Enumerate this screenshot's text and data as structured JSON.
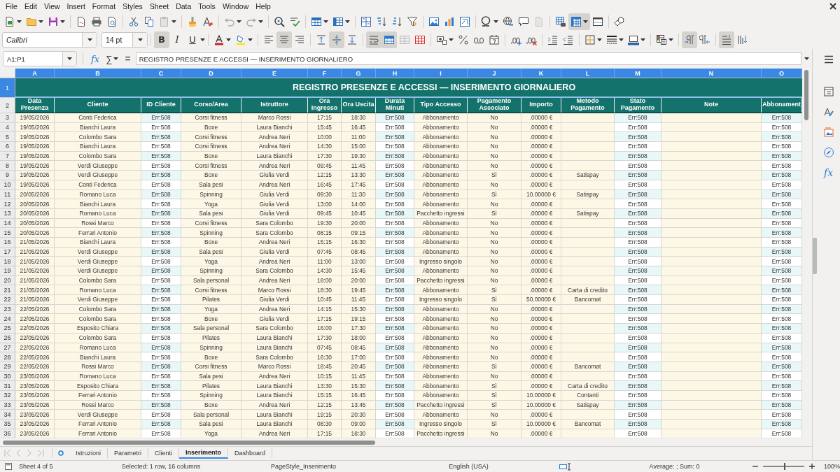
{
  "menu": [
    "File",
    "Edit",
    "View",
    "Insert",
    "Format",
    "Styles",
    "Sheet",
    "Data",
    "Tools",
    "Window",
    "Help"
  ],
  "standard_bar": {
    "pressed": {
      "freeze": true
    }
  },
  "format_bar": {
    "font_name": "Calibri",
    "font_size": "14 pt",
    "style_buttons": [
      {
        "kind": "bold",
        "label": "B",
        "pressed": true
      },
      {
        "kind": "italic",
        "label": "I",
        "pressed": false
      },
      {
        "kind": "underline",
        "label": "U",
        "pressed": false
      }
    ],
    "pressed": {
      "align_left": false,
      "align_center": true,
      "align_right": false,
      "valign_top": false,
      "valign_middle": true,
      "valign_bottom": false,
      "wrap_text": true,
      "merge_cells": true,
      "ltr": true,
      "rtl": false,
      "text_horizontal": true,
      "text_vertical": false
    }
  },
  "formula_bar": {
    "name_box": "A1:P1",
    "function_wizard": "fx",
    "sum": "∑",
    "equals": "=",
    "content": "REGISTRO PRESENZE E ACCESSI — INSERIMENTO GIORNALIERO"
  },
  "sheet": {
    "columns": [
      {
        "letter": "A",
        "header": "Data Presenza",
        "selected": true
      },
      {
        "letter": "B",
        "header": "Cliente",
        "selected": true
      },
      {
        "letter": "C",
        "header": "ID Cliente",
        "selected": true
      },
      {
        "letter": "D",
        "header": "Corso/Area",
        "selected": true
      },
      {
        "letter": "E",
        "header": "Istruttore",
        "selected": true
      },
      {
        "letter": "F",
        "header": "Ora Ingresso",
        "selected": true
      },
      {
        "letter": "G",
        "header": "Ora Uscita",
        "selected": true
      },
      {
        "letter": "H",
        "header": "Durata Minuti",
        "selected": true
      },
      {
        "letter": "I",
        "header": "Tipo Accesso",
        "selected": true
      },
      {
        "letter": "J",
        "header": "Pagamento Associato",
        "selected": true
      },
      {
        "letter": "K",
        "header": "Importo",
        "selected": true
      },
      {
        "letter": "L",
        "header": "Metodo Pagamento",
        "selected": true
      },
      {
        "letter": "M",
        "header": "Stato Pagamento",
        "selected": true
      },
      {
        "letter": "N",
        "header": "Note",
        "selected": true
      },
      {
        "letter": "O",
        "header": "Abbonament",
        "selected": true
      }
    ],
    "title_row": {
      "number": "1",
      "title": "REGISTRO PRESENZE E ACCESSI — INSERIMENTO GIORNALIERO",
      "selected": true
    },
    "header_row": {
      "number": "2",
      "selected": false
    },
    "rows": [
      {
        "number": "3",
        "selected": false,
        "cells": [
          "19/05/2026",
          "Conti Federica",
          "Err:508",
          "Corsi fitness",
          "Marco Rossi",
          "17:15",
          "18:30",
          "Err:508",
          "Abbonamento",
          "No",
          ".00000 €",
          null,
          "Err:508",
          null,
          "Err:508"
        ]
      },
      {
        "number": "4",
        "selected": false,
        "cells": [
          "19/05/2026",
          "Bianchi Laura",
          "Err:508",
          "Boxe",
          "Laura Bianchi",
          "15:45",
          "16:45",
          "Err:508",
          "Abbonamento",
          "No",
          ".00000 €",
          null,
          "Err:508",
          null,
          "Err:508"
        ]
      },
      {
        "number": "5",
        "selected": false,
        "cells": [
          "19/05/2026",
          "Colombo Sara",
          "Err:508",
          "Corsi fitness",
          "Andrea Neri",
          "10:00",
          "11:00",
          "Err:508",
          "Abbonamento",
          "No",
          ".00000 €",
          null,
          "Err:508",
          null,
          "Err:508"
        ]
      },
      {
        "number": "6",
        "selected": false,
        "cells": [
          "19/05/2026",
          "Bianchi Laura",
          "Err:508",
          "Corsi fitness",
          "Andrea Neri",
          "14:30",
          "15:00",
          "Err:508",
          "Abbonamento",
          "No",
          ".00000 €",
          null,
          "Err:508",
          null,
          "Err:508"
        ]
      },
      {
        "number": "7",
        "selected": false,
        "cells": [
          "19/05/2026",
          "Colombo Sara",
          "Err:508",
          "Boxe",
          "Laura Bianchi",
          "17:30",
          "19:30",
          "Err:508",
          "Abbonamento",
          "No",
          ".00000 €",
          null,
          "Err:508",
          null,
          "Err:508"
        ]
      },
      {
        "number": "8",
        "selected": false,
        "cells": [
          "19/05/2026",
          "Verdi Giuseppe",
          "Err:508",
          "Corsi fitness",
          "Andrea Neri",
          "09:45",
          "11:45",
          "Err:508",
          "Abbonamento",
          "No",
          ".00000 €",
          null,
          "Err:508",
          null,
          "Err:508"
        ]
      },
      {
        "number": "9",
        "selected": false,
        "cells": [
          "19/05/2026",
          "Verdi Giuseppe",
          "Err:508",
          "Boxe",
          "Giulia Verdi",
          "12:15",
          "13:30",
          "Err:508",
          "Abbonamento",
          "Sì",
          ".00000 €",
          "Satispay",
          "Err:508",
          null,
          "Err:508"
        ]
      },
      {
        "number": "10",
        "selected": false,
        "cells": [
          "19/05/2026",
          "Conti Federica",
          "Err:508",
          "Sala pesi",
          "Andrea Neri",
          "16:45",
          "17:45",
          "Err:508",
          "Abbonamento",
          "No",
          ".00000 €",
          null,
          "Err:508",
          null,
          "Err:508"
        ]
      },
      {
        "number": "11",
        "selected": false,
        "cells": [
          "20/05/2026",
          "Romano Luca",
          "Err:508",
          "Spinning",
          "Giulia Verdi",
          "09:30",
          "11:30",
          "Err:508",
          "Abbonamento",
          "Sì",
          "10.00000 €",
          "Satispay",
          "Err:508",
          null,
          "Err:508"
        ]
      },
      {
        "number": "12",
        "selected": false,
        "cells": [
          "20/05/2026",
          "Bianchi Laura",
          "Err:508",
          "Yoga",
          "Giulia Verdi",
          "13:00",
          "14:00",
          "Err:508",
          "Abbonamento",
          "No",
          ".00000 €",
          null,
          "Err:508",
          null,
          "Err:508"
        ]
      },
      {
        "number": "13",
        "selected": false,
        "cells": [
          "20/05/2026",
          "Romano Luca",
          "Err:508",
          "Sala pesi",
          "Giulia Verdi",
          "09:45",
          "10:45",
          "Err:508",
          "Pacchetto ingressi",
          "Sì",
          ".00000 €",
          "Satispay",
          "Err:508",
          null,
          "Err:508"
        ]
      },
      {
        "number": "14",
        "selected": false,
        "cells": [
          "20/05/2026",
          "Rossi Marco",
          "Err:508",
          "Corsi fitness",
          "Sara Colombo",
          "19:30",
          "20:00",
          "Err:508",
          "Abbonamento",
          "No",
          ".00000 €",
          null,
          "Err:508",
          null,
          "Err:508"
        ]
      },
      {
        "number": "15",
        "selected": false,
        "cells": [
          "20/05/2026",
          "Ferrari Antonio",
          "Err:508",
          "Spinning",
          "Sara Colombo",
          "08:15",
          "09:15",
          "Err:508",
          "Abbonamento",
          "No",
          ".00000 €",
          null,
          "Err:508",
          null,
          "Err:508"
        ]
      },
      {
        "number": "16",
        "selected": false,
        "cells": [
          "21/05/2026",
          "Bianchi Laura",
          "Err:508",
          "Boxe",
          "Andrea Neri",
          "15:15",
          "16:30",
          "Err:508",
          "Abbonamento",
          "No",
          ".00000 €",
          null,
          "Err:508",
          null,
          "Err:508"
        ]
      },
      {
        "number": "17",
        "selected": false,
        "cells": [
          "21/05/2026",
          "Verdi Giuseppe",
          "Err:508",
          "Sala pesi",
          "Giulia Verdi",
          "07:45",
          "08:45",
          "Err:508",
          "Abbonamento",
          "No",
          ".00000 €",
          null,
          "Err:508",
          null,
          "Err:508"
        ]
      },
      {
        "number": "18",
        "selected": false,
        "cells": [
          "21/05/2026",
          "Verdi Giuseppe",
          "Err:508",
          "Yoga",
          "Andrea Neri",
          "11:00",
          "13:00",
          "Err:508",
          "Ingresso singolo",
          "No",
          ".00000 €",
          null,
          "Err:508",
          null,
          "Err:508"
        ]
      },
      {
        "number": "19",
        "selected": false,
        "cells": [
          "21/05/2026",
          "Verdi Giuseppe",
          "Err:508",
          "Spinning",
          "Sara Colombo",
          "14:30",
          "15:45",
          "Err:508",
          "Abbonamento",
          "No",
          ".00000 €",
          null,
          "Err:508",
          null,
          "Err:508"
        ]
      },
      {
        "number": "20",
        "selected": false,
        "cells": [
          "21/05/2026",
          "Colombo Sara",
          "Err:508",
          "Sala personal",
          "Andrea Neri",
          "18:00",
          "20:00",
          "Err:508",
          "Pacchetto ingressi",
          "No",
          ".00000 €",
          null,
          "Err:508",
          null,
          "Err:508"
        ]
      },
      {
        "number": "21",
        "selected": false,
        "cells": [
          "21/05/2026",
          "Romano Luca",
          "Err:508",
          "Corsi fitness",
          "Marco Rossi",
          "18:30",
          "19:45",
          "Err:508",
          "Abbonamento",
          "Sì",
          ".00000 €",
          "Carta di credito",
          "Err:508",
          null,
          "Err:508"
        ]
      },
      {
        "number": "22",
        "selected": false,
        "cells": [
          "21/05/2026",
          "Verdi Giuseppe",
          "Err:508",
          "Pilates",
          "Giulia Verdi",
          "10:45",
          "11:45",
          "Err:508",
          "Ingresso singolo",
          "Sì",
          "50.00000 €",
          "Bancomat",
          "Err:508",
          null,
          "Err:508"
        ]
      },
      {
        "number": "23",
        "selected": false,
        "cells": [
          "22/05/2026",
          "Colombo Sara",
          "Err:508",
          "Yoga",
          "Andrea Neri",
          "14:15",
          "15:30",
          "Err:508",
          "Abbonamento",
          "No",
          ".00000 €",
          null,
          "Err:508",
          null,
          "Err:508"
        ]
      },
      {
        "number": "24",
        "selected": false,
        "cells": [
          "22/05/2026",
          "Colombo Sara",
          "Err:508",
          "Boxe",
          "Giulia Verdi",
          "17:15",
          "19:15",
          "Err:508",
          "Abbonamento",
          "No",
          ".00000 €",
          null,
          "Err:508",
          null,
          "Err:508"
        ]
      },
      {
        "number": "25",
        "selected": false,
        "cells": [
          "22/05/2026",
          "Esposito Chiara",
          "Err:508",
          "Sala personal",
          "Sara Colombo",
          "16:00",
          "17:30",
          "Err:508",
          "Abbonamento",
          "No",
          ".00000 €",
          null,
          "Err:508",
          null,
          "Err:508"
        ]
      },
      {
        "number": "26",
        "selected": false,
        "cells": [
          "22/05/2026",
          "Colombo Sara",
          "Err:508",
          "Pilates",
          "Laura Bianchi",
          "17:30",
          "18:00",
          "Err:508",
          "Abbonamento",
          "No",
          ".00000 €",
          null,
          "Err:508",
          null,
          "Err:508"
        ]
      },
      {
        "number": "27",
        "selected": false,
        "cells": [
          "22/05/2026",
          "Romano Luca",
          "Err:508",
          "Spinning",
          "Laura Bianchi",
          "07:45",
          "08:45",
          "Err:508",
          "Abbonamento",
          "No",
          ".00000 €",
          null,
          "Err:508",
          null,
          "Err:508"
        ]
      },
      {
        "number": "28",
        "selected": false,
        "cells": [
          "22/05/2026",
          "Bianchi Laura",
          "Err:508",
          "Boxe",
          "Sara Colombo",
          "16:30",
          "17:00",
          "Err:508",
          "Abbonamento",
          "No",
          ".00000 €",
          null,
          "Err:508",
          null,
          "Err:508"
        ]
      },
      {
        "number": "29",
        "selected": false,
        "cells": [
          "22/05/2026",
          "Rossi Marco",
          "Err:508",
          "Corsi fitness",
          "Marco Rossi",
          "18:45",
          "20:45",
          "Err:508",
          "Abbonamento",
          "Sì",
          ".00000 €",
          "Bancomat",
          "Err:508",
          null,
          "Err:508"
        ]
      },
      {
        "number": "30",
        "selected": false,
        "cells": [
          "23/05/2026",
          "Romano Luca",
          "Err:508",
          "Sala pesi",
          "Andrea Neri",
          "10:15",
          "11:45",
          "Err:508",
          "Abbonamento",
          "No",
          ".00000 €",
          null,
          "Err:508",
          null,
          "Err:508"
        ]
      },
      {
        "number": "31",
        "selected": false,
        "cells": [
          "23/05/2026",
          "Esposito Chiara",
          "Err:508",
          "Pilates",
          "Laura Bianchi",
          "13:30",
          "15:30",
          "Err:508",
          "Abbonamento",
          "Sì",
          ".00000 €",
          "Carta di credito",
          "Err:508",
          null,
          "Err:508"
        ]
      },
      {
        "number": "32",
        "selected": false,
        "cells": [
          "23/05/2026",
          "Ferrari Antonio",
          "Err:508",
          "Spinning",
          "Laura Bianchi",
          "15:15",
          "16:45",
          "Err:508",
          "Abbonamento",
          "Sì",
          "10.00000 €",
          "Contanti",
          "Err:508",
          null,
          "Err:508"
        ]
      },
      {
        "number": "33",
        "selected": false,
        "cells": [
          "23/05/2026",
          "Rossi Marco",
          "Err:508",
          "Boxe",
          "Andrea Neri",
          "12:15",
          "13:45",
          "Err:508",
          "Pacchetto ingressi",
          "Sì",
          "10.00000 €",
          "Satispay",
          "Err:508",
          null,
          "Err:508"
        ]
      },
      {
        "number": "34",
        "selected": false,
        "cells": [
          "23/05/2026",
          "Verdi Giuseppe",
          "Err:508",
          "Sala personal",
          "Laura Bianchi",
          "19:15",
          "20:30",
          "Err:508",
          "Abbonamento",
          "No",
          ".00000 €",
          null,
          "Err:508",
          null,
          "Err:508"
        ]
      },
      {
        "number": "35",
        "selected": false,
        "cells": [
          "23/05/2026",
          "Ferrari Antonio",
          "Err:508",
          "Sala pesi",
          "Laura Bianchi",
          "08:30",
          "09:00",
          "Err:508",
          "Ingresso singolo",
          "Sì",
          "10.00000 €",
          "Bancomat",
          "Err:508",
          null,
          "Err:508"
        ]
      },
      {
        "number": "36",
        "selected": false,
        "cells": [
          "23/05/2026",
          "Ferrari Antonio",
          "Err:508",
          "Yoga",
          "Andrea Neri",
          "17:15",
          "18:30",
          "Err:508",
          "Pacchetto ingressi",
          "No",
          ".00000 €",
          null,
          "Err:508",
          null,
          "Err:508"
        ]
      }
    ]
  },
  "sidebar": {
    "functions_label": "fx"
  },
  "sheet_tabs": [
    {
      "label": "Istruzioni",
      "selected": false
    },
    {
      "label": "Parametri",
      "selected": false
    },
    {
      "label": "Clienti",
      "selected": false
    },
    {
      "label": "Inserimento",
      "selected": true
    },
    {
      "label": "Dashboard",
      "selected": false
    }
  ],
  "status_bar": {
    "sheet": "Sheet 4 of 5",
    "selection": "Selected: 1 row, 16 columns",
    "page_style": "PageStyle_Inserimento",
    "language": "English (USA)",
    "summary": "Average: ; Sum: 0",
    "zoom": {
      "level": 0.5
    },
    "zoom_label": "100%"
  }
}
